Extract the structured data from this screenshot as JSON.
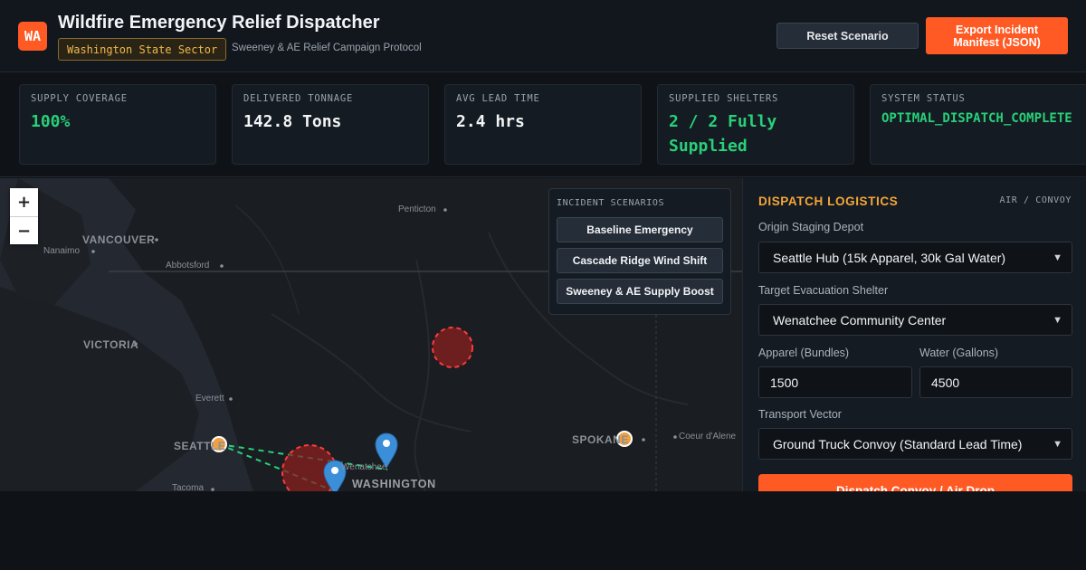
{
  "header": {
    "logo": "WA",
    "title": "Wildfire Emergency Relief Dispatcher",
    "sector_badge": "Washington State Sector",
    "protocol": "Sweeney & AE Relief Campaign Protocol",
    "reset_label": "Reset Scenario",
    "export_label": "Export Incident Manifest (JSON)"
  },
  "kpis": [
    {
      "label": "SUPPLY COVERAGE",
      "value": "100%"
    },
    {
      "label": "DELIVERED TONNAGE",
      "value": "142.8 Tons"
    },
    {
      "label": "AVG LEAD TIME",
      "value": "2.4 hrs"
    },
    {
      "label": "SUPPLIED SHELTERS",
      "value": "2 / 2 Fully Supplied"
    },
    {
      "label": "SYSTEM STATUS",
      "value": "OPTIMAL_DISPATCH_COMPLETE"
    }
  ],
  "map": {
    "zoom_in": "+",
    "zoom_out": "−",
    "labels": {
      "penticton": "Penticton",
      "vancouver": "VANCOUVER",
      "nanaimo": "Nanaimo",
      "abbotsford": "Abbotsford",
      "victoria": "VICTORIA",
      "everett": "Everett",
      "seattle": "SEATTLE",
      "tacoma": "Tacoma",
      "wenatchee": "Wenatchee",
      "washington": "WASHINGTON",
      "spokane": "SPOKANE",
      "coeur": "Coeur d'Alene"
    },
    "colors": {
      "fire_zone": "#8a1f1f",
      "fire_stroke": "#ff3b3b",
      "depot": "#f0a040",
      "shelter_pin": "#3b8fd9",
      "route": "#28d07a"
    }
  },
  "scenarios": {
    "title": "INCIDENT SCENARIOS",
    "items": [
      "Baseline Emergency",
      "Cascade Ridge Wind Shift",
      "Sweeney & AE Supply Boost"
    ]
  },
  "dispatch": {
    "title": "DISPATCH LOGISTICS",
    "tag": "AIR / CONVOY",
    "origin_label": "Origin Staging Depot",
    "origin_value": "Seattle Hub (15k Apparel, 30k Gal Water)",
    "shelter_label": "Target Evacuation Shelter",
    "shelter_value": "Wenatchee Community Center",
    "apparel_label": "Apparel (Bundles)",
    "apparel_value": "1500",
    "water_label": "Water (Gallons)",
    "water_value": "4500",
    "transport_label": "Transport Vector",
    "transport_value": "Ground Truck Convoy (Standard Lead Time)",
    "dispatch_label": "Dispatch Convoy / Air Drop"
  }
}
